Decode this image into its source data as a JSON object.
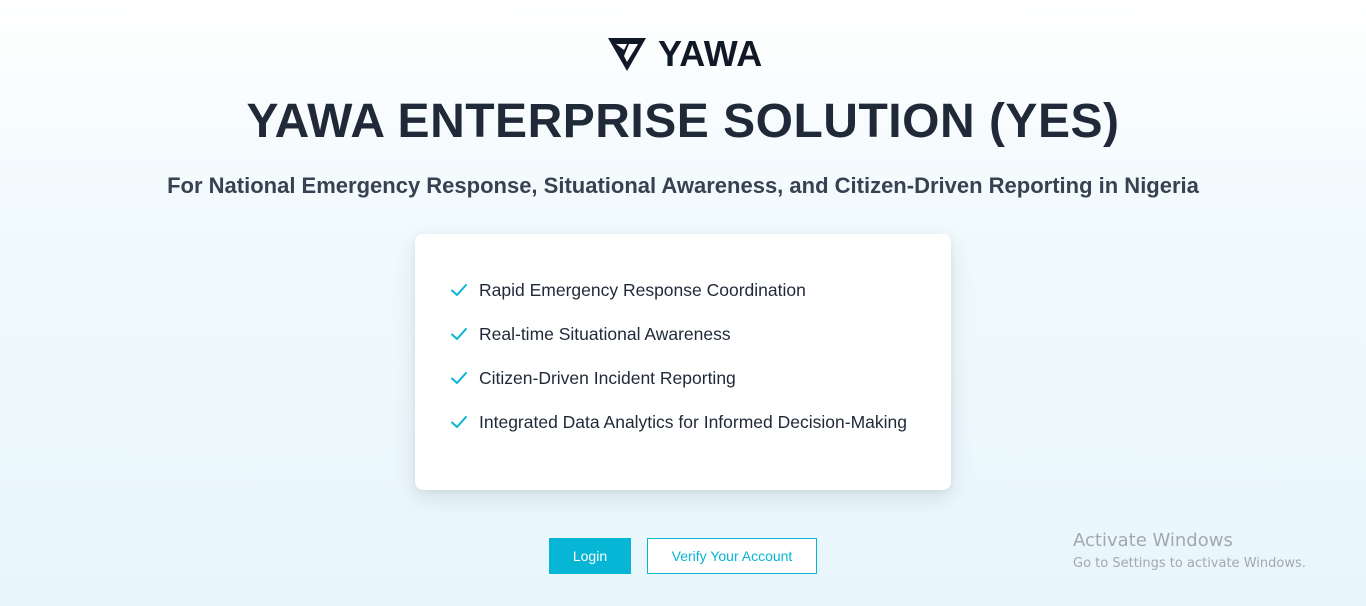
{
  "brand": {
    "name": "YAWA",
    "icon": "yawa-logo-icon"
  },
  "hero": {
    "title": "YAWA ENTERPRISE SOLUTION (YES)",
    "subtitle": "For National Emergency Response, Situational Awareness, and Citizen-Driven Reporting in Nigeria"
  },
  "features": {
    "icon": "check-icon",
    "accent_color": "#06b6d4",
    "items": [
      {
        "label": "Rapid Emergency Response Coordination"
      },
      {
        "label": "Real-time Situational Awareness"
      },
      {
        "label": "Citizen-Driven Incident Reporting"
      },
      {
        "label": "Integrated Data Analytics for Informed Decision-Making"
      }
    ]
  },
  "actions": {
    "login_label": "Login",
    "verify_label": "Verify Your Account",
    "primary_color": "#06b6d4"
  },
  "os_watermark": {
    "title": "Activate Windows",
    "subtitle": "Go to Settings to activate Windows."
  }
}
